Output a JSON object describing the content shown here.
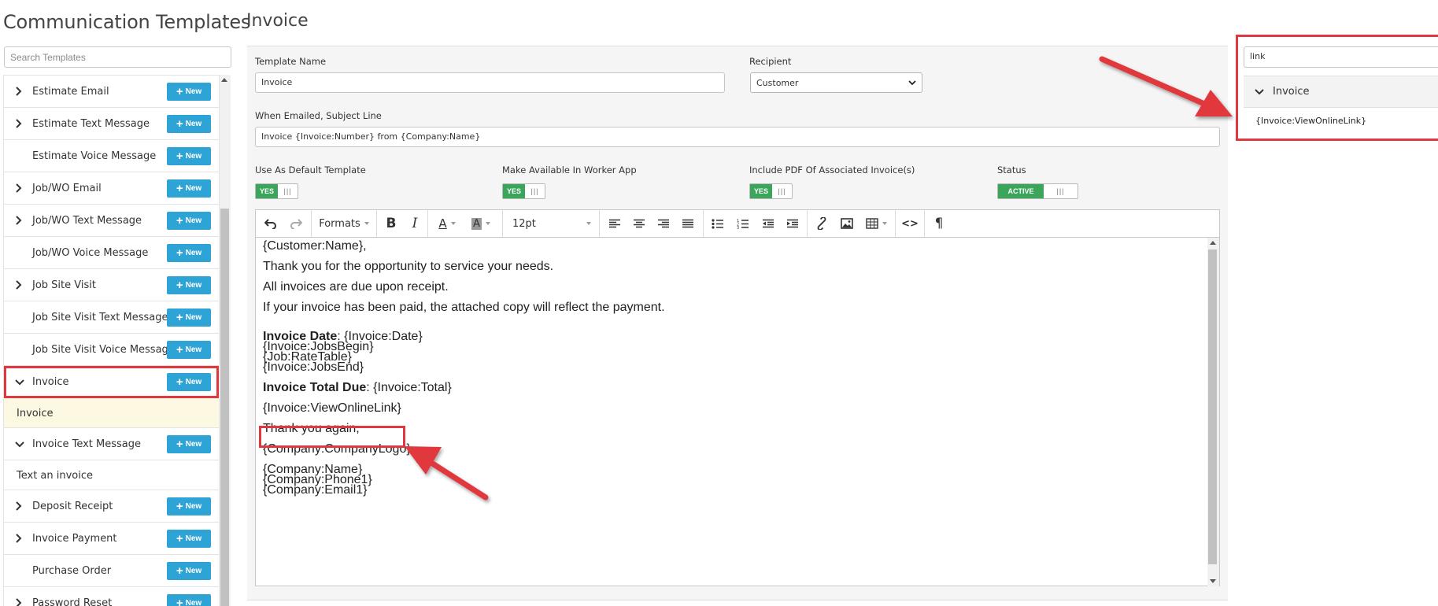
{
  "sidebar": {
    "title": "Communication Templates",
    "search_placeholder": "Search Templates",
    "new_label": "New",
    "items": [
      {
        "label": "Estimate Email",
        "chevron": "right"
      },
      {
        "label": "Estimate Text Message",
        "chevron": "right"
      },
      {
        "label": "Estimate Voice Message",
        "chevron": "none"
      },
      {
        "label": "Job/WO Email",
        "chevron": "right"
      },
      {
        "label": "Job/WO Text Message",
        "chevron": "right"
      },
      {
        "label": "Job/WO Voice Message",
        "chevron": "none"
      },
      {
        "label": "Job Site Visit",
        "chevron": "right"
      },
      {
        "label": "Job Site Visit Text Message",
        "chevron": "none"
      },
      {
        "label": "Job Site Visit Voice Message",
        "chevron": "none"
      },
      {
        "label": "Invoice",
        "chevron": "down",
        "selected": true,
        "children": [
          "Invoice"
        ]
      },
      {
        "label": "Invoice Text Message",
        "chevron": "down",
        "children": [
          "Text an invoice"
        ]
      },
      {
        "label": "Deposit Receipt",
        "chevron": "right"
      },
      {
        "label": "Invoice Payment",
        "chevron": "right"
      },
      {
        "label": "Purchase Order",
        "chevron": "none"
      },
      {
        "label": "Password Reset",
        "chevron": "right"
      }
    ]
  },
  "main": {
    "title": "Invoice",
    "template_name_label": "Template Name",
    "template_name_value": "Invoice",
    "recipient_label": "Recipient",
    "recipient_value": "Customer",
    "subject_label": "When Emailed, Subject Line",
    "subject_value": "Invoice {Invoice:Number} from {Company:Name}",
    "toggles": [
      {
        "label": "Use As Default Template",
        "value": "YES"
      },
      {
        "label": "Make Available In Worker App",
        "value": "YES"
      },
      {
        "label": "Include PDF Of Associated Invoice(s)",
        "value": "YES"
      },
      {
        "label": "Status",
        "value": "ACTIVE"
      }
    ],
    "toolbar": {
      "formats": "Formats",
      "font_size": "12pt",
      "bold": "B",
      "italic": "I",
      "text_color": "A",
      "bg_color": "A",
      "code": "<>",
      "paragraph": "¶"
    },
    "editor": {
      "greeting": "{Customer:Name},",
      "p1": "Thank you for the opportunity to service your needs.",
      "p2": "All invoices are due upon receipt.",
      "p3": "If your invoice has been paid, the attached copy will reflect the payment.",
      "invoice_date_label": "Invoice Date",
      "invoice_date_value": ": {Invoice:Date}",
      "jobs_begin": "{Invoice:JobsBegin}",
      "rate_table": "{Job:RateTable}",
      "jobs_end": "{Invoice:JobsEnd}",
      "total_label": "Invoice Total Due",
      "total_value": ": {Invoice:Total}",
      "view_link": "{Invoice:ViewOnlineLink}",
      "thanks": "Thank you again,",
      "logo": "{Company:CompanyLogo}",
      "company_name": "{Company:Name}",
      "company_phone": "{Company:Phone1}",
      "company_email": "{Company:Email1}"
    }
  },
  "field_search": {
    "value": "link",
    "group_label": "Invoice",
    "result": "{Invoice:ViewOnlineLink}"
  },
  "colors": {
    "accent_blue": "#2ea3d6",
    "toggle_green": "#3ba55c",
    "highlight_red": "#e0383e",
    "selected_row": "#fdf8e1"
  }
}
